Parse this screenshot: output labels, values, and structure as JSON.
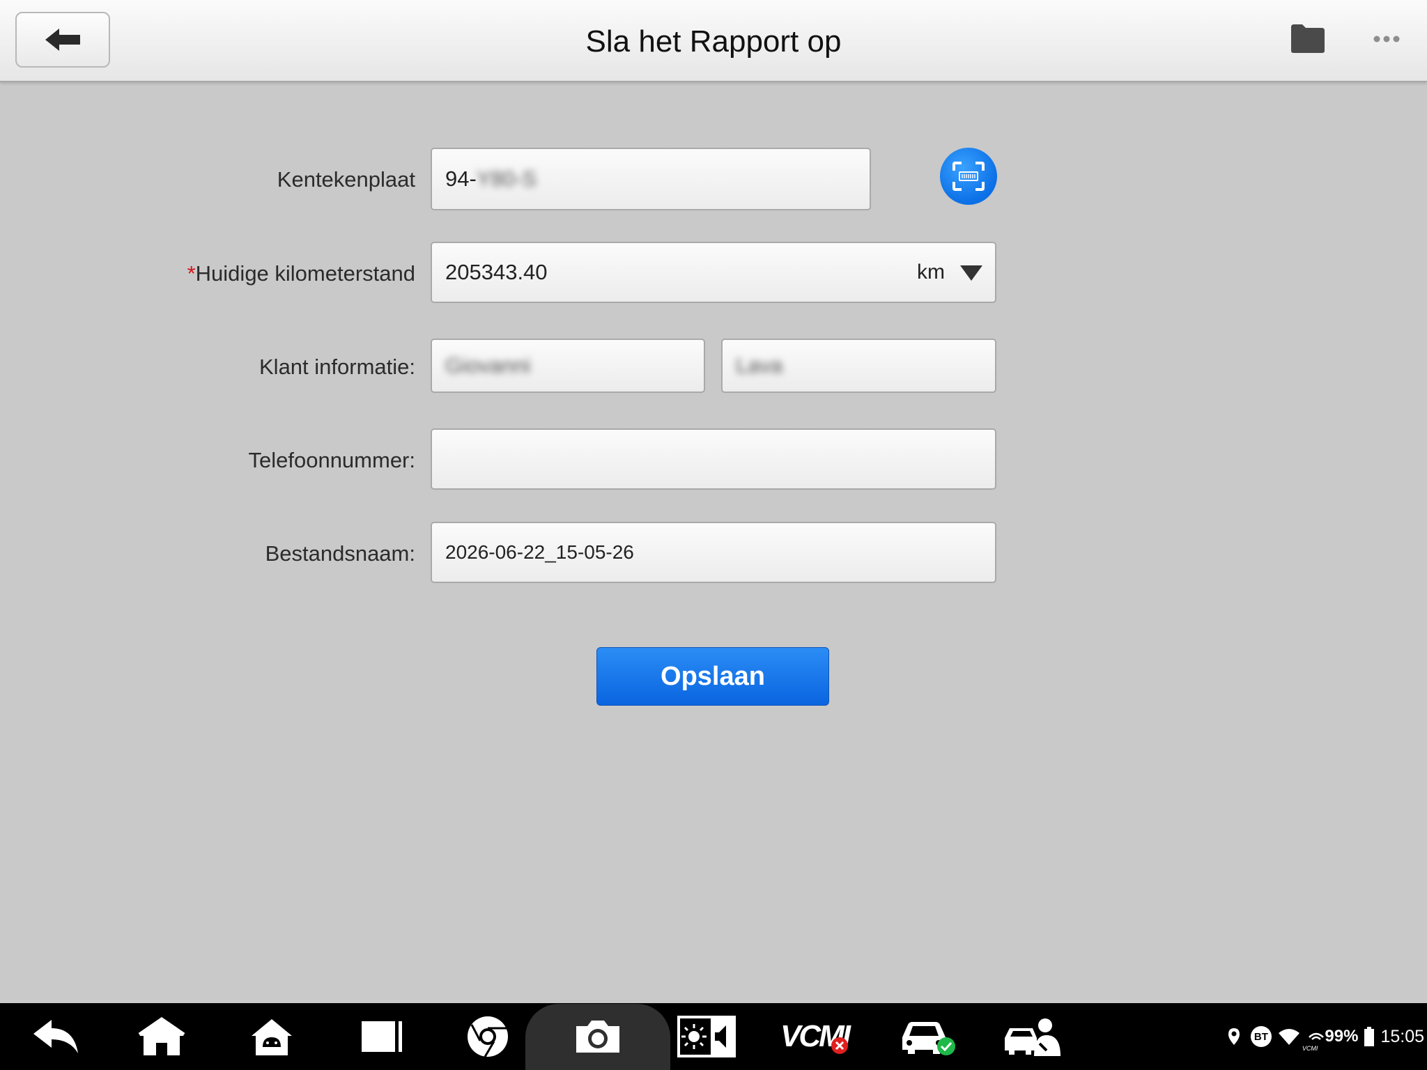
{
  "header": {
    "title": "Sla het Rapport op"
  },
  "form": {
    "license_plate": {
      "label": "Kentekenplaat",
      "value": "94-Y80-S"
    },
    "mileage": {
      "required_marker": "*",
      "label": "Huidige kilometerstand",
      "value": "205343.40",
      "unit": "km"
    },
    "customer": {
      "label": "Klant informatie:",
      "first_name": "Giovanni",
      "last_name": "Lava"
    },
    "phone": {
      "label": "Telefoonnummer:",
      "value": ""
    },
    "filename": {
      "label": "Bestandsnaam:",
      "value": "2026-06-22_15-05-26"
    },
    "save_label": "Opslaan"
  },
  "icons": {
    "back": "back-arrow-icon",
    "folder": "folder-icon",
    "more": "more-dots-icon",
    "scan": "barcode-scan-icon"
  },
  "colors": {
    "accent": "#0b6fe6",
    "required": "#d0181e",
    "background": "#c9c9c9"
  },
  "navbar": {
    "vcm_label": "VCMI"
  },
  "status": {
    "bt": "BT",
    "vcmi_small": "VCMI",
    "battery": "99%",
    "time": "15:05"
  }
}
